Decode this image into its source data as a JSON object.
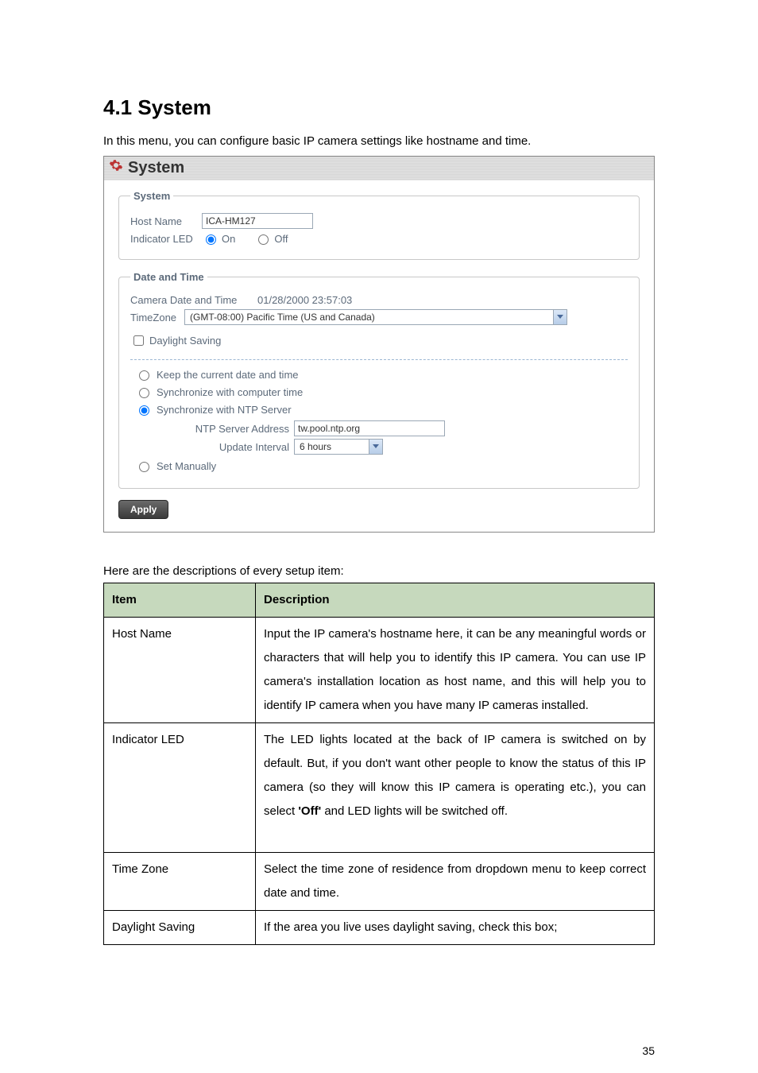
{
  "heading": "4.1 System",
  "intro": "In this menu, you can configure basic IP camera settings like hostname and time.",
  "panel": {
    "title": "System",
    "system_group": {
      "legend": "System",
      "hostname_label": "Host Name",
      "hostname_value": "ICA-HM127",
      "indicator_label": "Indicator LED",
      "on_label": "On",
      "off_label": "Off"
    },
    "datetime_group": {
      "legend": "Date and Time",
      "camera_dt_label": "Camera Date and Time",
      "camera_dt_value": "01/28/2000 23:57:03",
      "timezone_label": "TimeZone",
      "timezone_value": "(GMT-08:00) Pacific Time (US and Canada)",
      "daylight_label": "Daylight Saving",
      "opt_keep": "Keep the current date and time",
      "opt_sync_pc": "Synchronize with computer time",
      "opt_sync_ntp": "Synchronize with NTP Server",
      "ntp_addr_label": "NTP Server Address",
      "ntp_addr_value": "tw.pool.ntp.org",
      "update_int_label": "Update Interval",
      "update_int_value": "6 hours",
      "opt_manual": "Set Manually"
    },
    "apply_label": "Apply"
  },
  "table_intro": "Here are the descriptions of every setup item:",
  "table": {
    "head_item": "Item",
    "head_desc": "Description",
    "rows": [
      {
        "item": "Host Name",
        "desc": "Input the IP camera's hostname here, it can be any meaningful words or characters that will help you to identify this IP camera. You can use IP camera's installation location as host name, and this will help you to identify IP camera when you have many IP cameras installed."
      },
      {
        "item": "Indicator LED",
        "desc_pre": "The LED lights located at the back of IP camera is switched on by default. But, if you don't want other people to know the status of this IP camera (so they will know this IP camera is operating etc.), you can select ",
        "desc_bold": "'Off'",
        "desc_post": " and LED lights will be switched off."
      },
      {
        "item": "Time Zone",
        "desc": "Select the time zone of residence from dropdown menu to keep correct date and time."
      },
      {
        "item": "Daylight Saving",
        "desc": "If the area you live uses daylight saving, check this box;"
      }
    ]
  },
  "page_number": "35"
}
